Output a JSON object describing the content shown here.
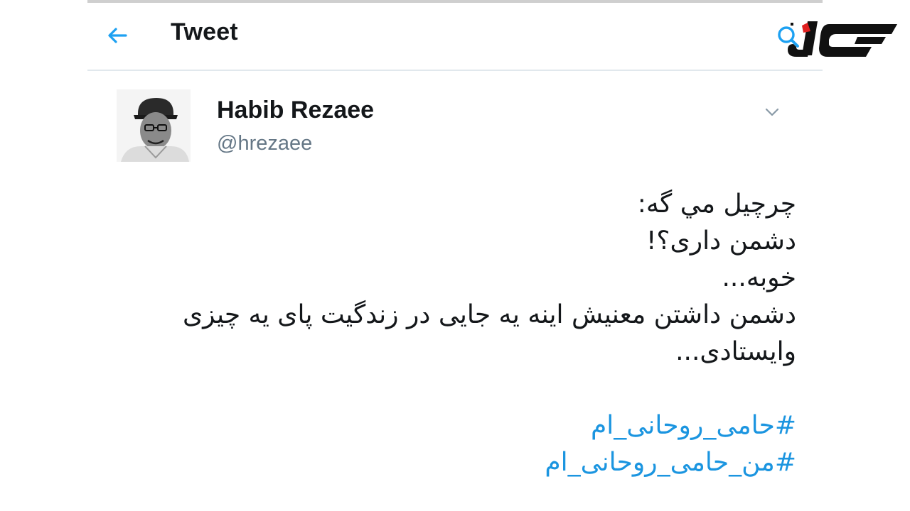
{
  "header": {
    "title": "Tweet",
    "back_icon": "arrow-left-icon",
    "search_icon": "search-icon",
    "accent_color": "#1da1f2"
  },
  "logo": {
    "name": "news-site-logo",
    "colors": [
      "#111111",
      "#e02020"
    ]
  },
  "tweet": {
    "author": {
      "display_name": "Habib Rezaee",
      "handle": "@hrezaee"
    },
    "menu_icon": "chevron-down-icon",
    "lines": [
      "چرچیل مي گه:",
      "دشمن داری؟!",
      "خوبه...",
      "دشمن داشتن معنیش اینه یه جایی در زندگیت پای یه چیزی",
      "وایستادی..."
    ],
    "hashtags": [
      "#حامی_روحانی_ام",
      "#من_حامی_روحانی_ام"
    ],
    "hashtag_color": "#1b95e0"
  }
}
